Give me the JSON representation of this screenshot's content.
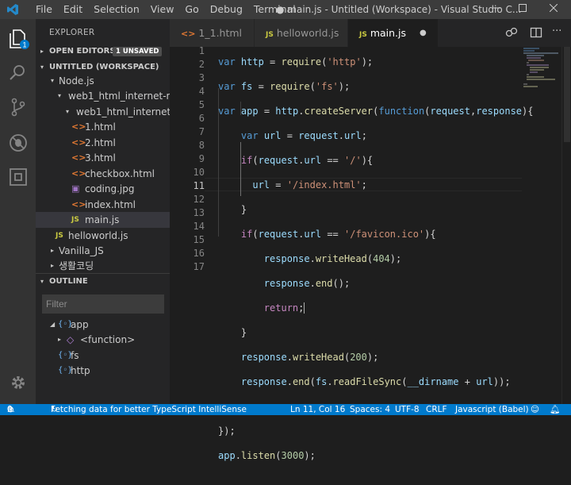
{
  "menu": [
    "File",
    "Edit",
    "Selection",
    "View",
    "Go",
    "Debug",
    "Terminal"
  ],
  "window_title": "● main.js - Untitled (Workspace) - Visual Studio C...",
  "explorer": {
    "title": "EXPLORER",
    "open_editors": "OPEN EDITORS",
    "unsaved_badge": "1 UNSAVED",
    "workspace": "UNTITLED (WORKSPACE)",
    "tree": [
      {
        "label": "Node.js",
        "type": "folder",
        "arrow": "▾"
      },
      {
        "label": "web1_html_internet-m...",
        "type": "folder",
        "arrow": "▾"
      },
      {
        "label": "web1_html_internet-...",
        "type": "folder",
        "arrow": "▾"
      },
      {
        "label": "1.html",
        "type": "html"
      },
      {
        "label": "2.html",
        "type": "html"
      },
      {
        "label": "3.html",
        "type": "html"
      },
      {
        "label": "checkbox.html",
        "type": "html"
      },
      {
        "label": "coding.jpg",
        "type": "image"
      },
      {
        "label": "index.html",
        "type": "html"
      },
      {
        "label": "main.js",
        "type": "js",
        "selected": true
      },
      {
        "label": "helloworld.js",
        "type": "js"
      },
      {
        "label": "Vanilla_JS",
        "type": "folder",
        "arrow": "▸"
      },
      {
        "label": "생활코딩",
        "type": "folder",
        "arrow": "▸"
      }
    ]
  },
  "outline": {
    "title": "OUTLINE",
    "filter_placeholder": "Filter",
    "items": [
      {
        "label": "app",
        "icon": "{◦}"
      },
      {
        "label": "<function>",
        "icon": "◇"
      },
      {
        "label": "fs",
        "icon": "{◦}"
      },
      {
        "label": "http",
        "icon": "{◦}"
      }
    ]
  },
  "tabs": [
    {
      "label": "1_1.html",
      "icon": "<>"
    },
    {
      "label": "helloworld.js",
      "icon": "JS"
    },
    {
      "label": "main.js",
      "icon": "JS",
      "active": true,
      "dirty_dot": "●"
    }
  ],
  "line_numbers": [
    "1",
    "2",
    "3",
    "4",
    "5",
    "6",
    "7",
    "8",
    "9",
    "10",
    "11",
    "12",
    "13",
    "14",
    "15",
    "16",
    "17"
  ],
  "current_line": "11",
  "statusbar": {
    "errors": "0",
    "warnings": "0",
    "message": "Fetching data for better TypeScript IntelliSense",
    "position": "Ln 11, Col 16",
    "spaces": "Spaces: 4",
    "encoding": "UTF-8",
    "eol": "CRLF",
    "language": "Javascript (Babel)"
  },
  "colors": {
    "accent": "#007acc",
    "titlebar": "#3c3c3c",
    "sidebar": "#252526",
    "editor": "#1e1e1e"
  }
}
